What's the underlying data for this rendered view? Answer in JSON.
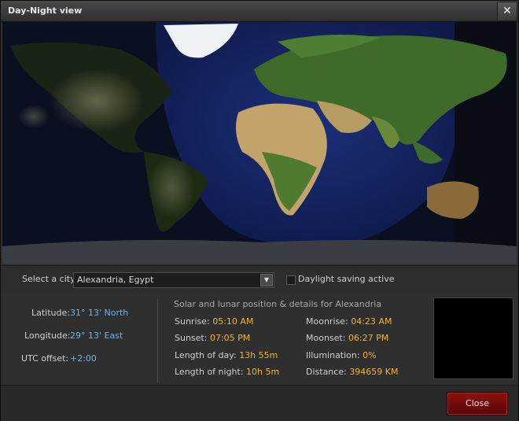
{
  "window": {
    "title": "Day-Night view",
    "close_glyph": "✕"
  },
  "map": {
    "description_icon": "world-map-day-night"
  },
  "controls": {
    "city_label": "Select a city:",
    "city_value": "Alexandria, Egypt",
    "dst_label": "Daylight saving active",
    "dst_checked": false
  },
  "location": {
    "latitude_label": "Latitude:",
    "latitude": "31° 13' North",
    "longitude_label": "Longitude:",
    "longitude": "29° 13' East",
    "utc_label": "UTC offset:",
    "utc": "+2:00"
  },
  "details": {
    "heading": "Solar and lunar position & details for Alexandria",
    "sunrise_label": "Sunrise:",
    "sunrise": "05:10 AM",
    "sunset_label": "Sunset:",
    "sunset": "07:05 PM",
    "day_label": "Length of day:",
    "day": "13h 55m",
    "night_label": "Length of night:",
    "night": "10h 5m",
    "moonrise_label": "Moonrise:",
    "moonrise": "04:23 AM",
    "moonset_label": "Moonset:",
    "moonset": "06:27 PM",
    "illum_label": "Illumination:",
    "illum": "0%",
    "dist_label": "Distance:",
    "dist": "394659 KM"
  },
  "footer": {
    "close_label": "Close"
  },
  "colors": {
    "accent_value": "#69b4e8",
    "highlight": "#f0b430",
    "close_button": "#7a0c0c"
  }
}
